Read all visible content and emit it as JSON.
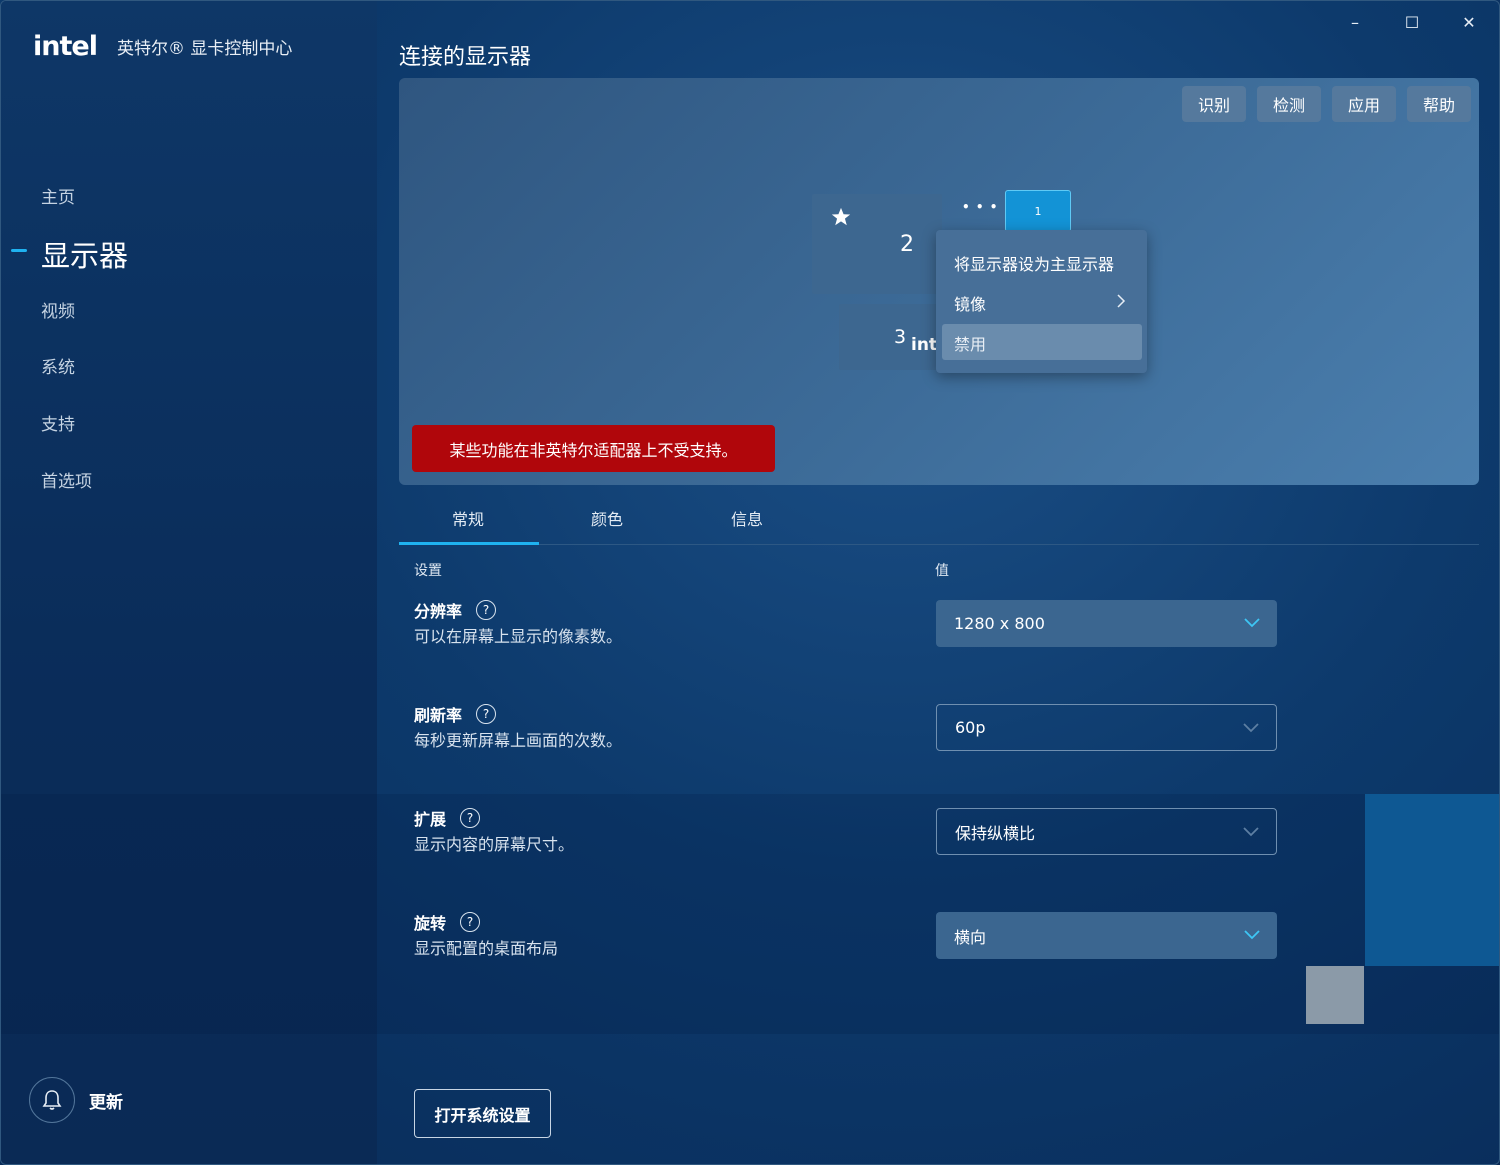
{
  "app": {
    "logo": "intel",
    "title": "英特尔® 显卡控制中心"
  },
  "window_controls": {
    "minimize": "–",
    "maximize": "☐",
    "close": "✕"
  },
  "nav": {
    "home": "主页",
    "display": "显示器",
    "video": "视频",
    "system": "系统",
    "support": "支持",
    "preferences": "首选项"
  },
  "update_label": "更新",
  "page_title": "连接的显示器",
  "toolbar": {
    "identify": "识别",
    "detect": "检测",
    "apply": "应用",
    "help": "帮助"
  },
  "monitors": {
    "m1_label": "1",
    "m2_label": "2",
    "m3_label": "3",
    "m3_sub": "intel",
    "more": "• • •"
  },
  "context_menu": {
    "set_primary": "将显示器设为主显示器",
    "mirror": "镜像",
    "disable": "禁用"
  },
  "warning": "某些功能在非英特尔适配器上不受支持。",
  "tabs": {
    "general": "常规",
    "color": "颜色",
    "info": "信息"
  },
  "columns": {
    "setting": "设置",
    "value": "值"
  },
  "settings": {
    "resolution": {
      "title": "分辨率",
      "desc": "可以在屏幕上显示的像素数。",
      "value": "1280 x 800"
    },
    "refresh": {
      "title": "刷新率",
      "desc": "每秒更新屏幕上画面的次数。",
      "value": "60p"
    },
    "scaling": {
      "title": "扩展",
      "desc": "显示内容的屏幕尺寸。",
      "value": "保持纵横比"
    },
    "rotation": {
      "title": "旋转",
      "desc": "显示配置的桌面布局",
      "value": "横向"
    }
  },
  "open_system_settings": "打开系统设置",
  "colors": {
    "accent": "#1fb2f0",
    "warning": "#b0060b"
  }
}
